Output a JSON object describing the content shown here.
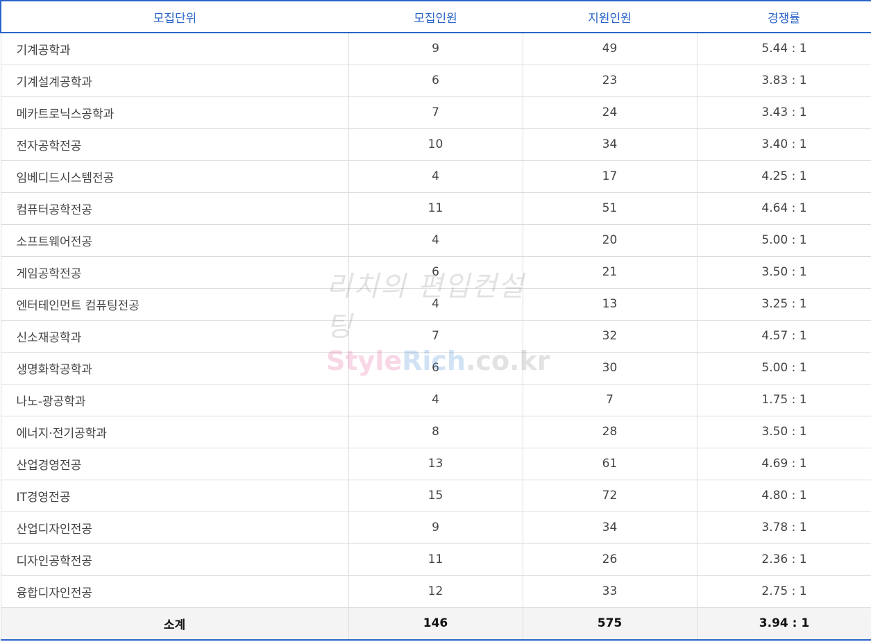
{
  "headers": [
    "모집단위",
    "모집인원",
    "지원인원",
    "경쟁률"
  ],
  "rows": [
    {
      "unit": "기계공학과",
      "quota": "9",
      "applicants": "49",
      "ratio": "5.44 : 1"
    },
    {
      "unit": "기계설계공학과",
      "quota": "6",
      "applicants": "23",
      "ratio": "3.83 : 1"
    },
    {
      "unit": "메카트로닉스공학과",
      "quota": "7",
      "applicants": "24",
      "ratio": "3.43 : 1"
    },
    {
      "unit": "전자공학전공",
      "quota": "10",
      "applicants": "34",
      "ratio": "3.40 : 1"
    },
    {
      "unit": "임베디드시스템전공",
      "quota": "4",
      "applicants": "17",
      "ratio": "4.25 : 1"
    },
    {
      "unit": "컴퓨터공학전공",
      "quota": "11",
      "applicants": "51",
      "ratio": "4.64 : 1"
    },
    {
      "unit": "소프트웨어전공",
      "quota": "4",
      "applicants": "20",
      "ratio": "5.00 : 1"
    },
    {
      "unit": "게임공학전공",
      "quota": "6",
      "applicants": "21",
      "ratio": "3.50 : 1"
    },
    {
      "unit": "엔터테인먼트 컴퓨팅전공",
      "quota": "4",
      "applicants": "13",
      "ratio": "3.25 : 1"
    },
    {
      "unit": "신소재공학과",
      "quota": "7",
      "applicants": "32",
      "ratio": "4.57 : 1"
    },
    {
      "unit": "생명화학공학과",
      "quota": "6",
      "applicants": "30",
      "ratio": "5.00 : 1"
    },
    {
      "unit": "나노-광공학과",
      "quota": "4",
      "applicants": "7",
      "ratio": "1.75 : 1"
    },
    {
      "unit": "에너지·전기공학과",
      "quota": "8",
      "applicants": "28",
      "ratio": "3.50 : 1"
    },
    {
      "unit": "산업경영전공",
      "quota": "13",
      "applicants": "61",
      "ratio": "4.69 : 1"
    },
    {
      "unit": "IT경영전공",
      "quota": "15",
      "applicants": "72",
      "ratio": "4.80 : 1"
    },
    {
      "unit": "산업디자인전공",
      "quota": "9",
      "applicants": "34",
      "ratio": "3.78 : 1"
    },
    {
      "unit": "디자인공학전공",
      "quota": "11",
      "applicants": "26",
      "ratio": "2.36 : 1"
    },
    {
      "unit": "융합디자인전공",
      "quota": "12",
      "applicants": "33",
      "ratio": "2.75 : 1"
    }
  ],
  "total": {
    "label": "소계",
    "quota": "146",
    "applicants": "575",
    "ratio": "3.94 : 1"
  },
  "watermark": {
    "line1": "리치의 편입컨설팅",
    "line2_s": "Style",
    "line2_r": "Rich",
    "line2_rest": ".co.kr"
  },
  "colors": {
    "accent": "#2a64c8",
    "border": "#dcdcdc",
    "total_bg": "#f4f4f4"
  }
}
